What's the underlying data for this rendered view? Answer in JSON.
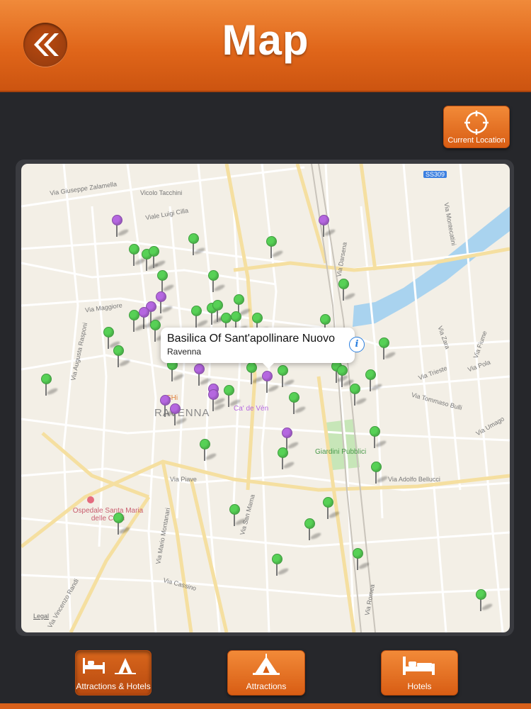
{
  "header": {
    "title": "Map",
    "back_icon": "double-chevron-left-icon"
  },
  "current_location": {
    "label": "Current Location",
    "icon": "crosshair-icon"
  },
  "callout": {
    "title": "Basilica Of Sant'apollinare Nuovo",
    "subtitle": "Ravenna",
    "info_icon": "info-icon"
  },
  "map_labels": {
    "city": "RAVENNA",
    "park": "Giardini Pubblici",
    "hospital": "Ospedale Santa Maria delle Croci",
    "legal": "Legal",
    "road_badge": "SS309",
    "hotel": "SHi",
    "cafe": "Ca' de Vèn",
    "streets": [
      "Via Giuseppe Zalamella",
      "Vicolo Tacchini",
      "Viale Luigi Cilla",
      "Via Maggiore",
      "Via Augusta Rasponi",
      "Via Piave",
      "Via Adolfo Bellucci",
      "Via Darsena",
      "Via Montecatini",
      "Via Mario Montanari",
      "Via Cassino",
      "Via San Mama",
      "Via Vincenzo Randi",
      "Via Romea",
      "Via Trieste",
      "Via Fiume",
      "Via Tommaso Bulli",
      "Via Umago",
      "Via Zara",
      "Via Pola"
    ]
  },
  "tabs": [
    {
      "label": "Attractions & Hotels",
      "icon": "bed-and-tent-icon"
    },
    {
      "label": "Attractions",
      "icon": "tent-icon"
    },
    {
      "label": "Hotels",
      "icon": "bed-icon"
    }
  ],
  "colors": {
    "accent": "#e0661a",
    "pin_green": "#57d156",
    "pin_purple": "#b567e0"
  }
}
